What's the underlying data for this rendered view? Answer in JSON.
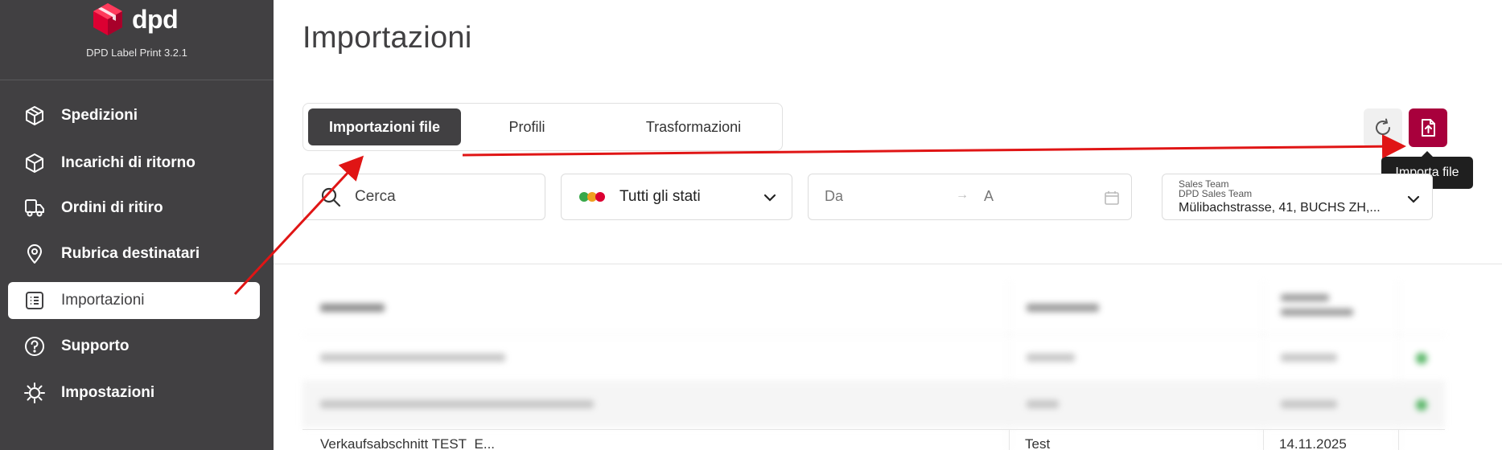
{
  "app": {
    "brand_name": "dpd",
    "version": "DPD Label Print 3.2.1",
    "brand_color": "#dc0032"
  },
  "sidebar": {
    "items": [
      {
        "label": "Spedizioni",
        "icon": "package-icon",
        "active": false
      },
      {
        "label": "Incarichi di ritorno",
        "icon": "return-package-icon",
        "active": false
      },
      {
        "label": "Ordini di ritiro",
        "icon": "truck-icon",
        "active": false
      },
      {
        "label": "Rubrica destinatari",
        "icon": "location-pin-icon",
        "active": false
      },
      {
        "label": "Importazioni",
        "icon": "list-icon",
        "active": true
      },
      {
        "label": "Supporto",
        "icon": "help-icon",
        "active": false
      },
      {
        "label": "Impostazioni",
        "icon": "gear-icon",
        "active": false
      }
    ]
  },
  "main": {
    "title": "Importazioni",
    "tabs": [
      {
        "label": "Importazioni file",
        "active": true
      },
      {
        "label": "Profili",
        "active": false
      },
      {
        "label": "Trasformazioni",
        "active": false
      }
    ],
    "actions": {
      "refresh_icon": "refresh-icon",
      "import_icon": "file-upload-icon",
      "import_tooltip": "Importa file",
      "import_color": "#a8003c"
    },
    "filters": {
      "search_placeholder": "Cerca",
      "status_label": "Tutti gli stati",
      "status_colors": [
        "#38a84a",
        "#f0a020",
        "#dc0032"
      ],
      "date_from": "Da",
      "date_arrow": "→",
      "date_to": "A",
      "sender_line1": "Sales Team",
      "sender_line2": "DPD Sales Team",
      "sender_line3": "Mülibachstrasse, 41, BUCHS ZH,..."
    },
    "table": {
      "visible_row": {
        "name": "Verkaufsabschnitt TEST_E...",
        "profile": "Test",
        "date": "14.11.2025"
      }
    }
  }
}
